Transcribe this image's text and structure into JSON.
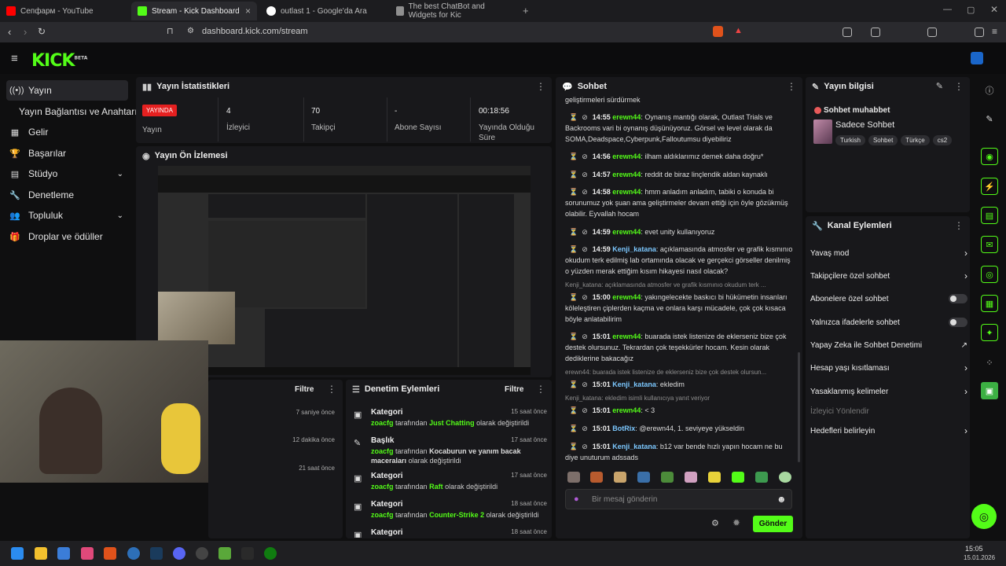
{
  "browser": {
    "tabs": [
      {
        "title": "Сепфарм - YouTube",
        "color": "#ff0000"
      },
      {
        "title": "Stream - Kick Dashboard",
        "color": "#53fc18"
      },
      {
        "title": "outlast 1 - Google'da Ara",
        "color": "#ffffff"
      },
      {
        "title": "The best ChatBot and Widgets for Kic",
        "color": "#8f8f8f"
      }
    ],
    "url": "dashboard.kick.com/stream"
  },
  "logo": {
    "text": "KICK",
    "beta": "BETA"
  },
  "sidebar": {
    "items": [
      {
        "icon": "((•))",
        "label": "Yayın"
      },
      {
        "icon": "",
        "label": "Yayın Bağlantısı ve Anahtarı"
      },
      {
        "icon": "▦",
        "label": "Gelir"
      },
      {
        "icon": "🏆",
        "label": "Başarılar"
      },
      {
        "icon": "▤",
        "label": "Stüdyo"
      },
      {
        "icon": "🔧",
        "label": "Denetleme"
      },
      {
        "icon": "👥",
        "label": "Topluluk"
      },
      {
        "icon": "🎁",
        "label": "Droplar ve ödüller"
      }
    ]
  },
  "stats": {
    "title": "Yayın İstatistikleri",
    "live_badge": "YAYINDA",
    "status_label": "Yayın",
    "viewers": {
      "value": "4",
      "label": "İzleyici"
    },
    "followers": {
      "value": "70",
      "label": "Takipçi"
    },
    "subs": {
      "value": "-",
      "label": "Abone Sayısı"
    },
    "uptime": {
      "value": "00:18:56",
      "label": "Yayında Olduğu Süre"
    }
  },
  "preview": {
    "title": "Yayın Ön İzlemesi"
  },
  "activity": {
    "filter": "Filtre",
    "times": [
      "7 saniye önce",
      "12 dakika önce",
      "21 saat önce"
    ]
  },
  "moderation": {
    "title": "Denetim Eylemleri",
    "filter": "Filtre",
    "items": [
      {
        "title": "Kategori",
        "user": "zoacfg",
        "pre": "tarafından",
        "value": "Just Chatting",
        "post": "olarak değiştirildi",
        "time": "15 saat önce"
      },
      {
        "title": "Başlık",
        "user": "zoacfg",
        "pre": "tarafından",
        "value": "Kocaburun ve yanım bacak maceraları",
        "post": "olarak değiştirildi",
        "time": "17 saat önce"
      },
      {
        "title": "Kategori",
        "user": "zoacfg",
        "pre": "tarafından",
        "value": "Raft",
        "post": "olarak değiştirildi",
        "time": "17 saat önce"
      },
      {
        "title": "Kategori",
        "user": "zoacfg",
        "pre": "tarafından",
        "value": "Counter-Strike 2",
        "post": "olarak değiştirildi",
        "time": "18 saat önce"
      },
      {
        "title": "Kategori",
        "user": "",
        "pre": "",
        "value": "",
        "post": "",
        "time": "18 saat önce"
      }
    ]
  },
  "chat": {
    "title": "Sohbet",
    "top": "geliştirmeleri sürdürmek",
    "messages": [
      {
        "time": "14:55",
        "user": "erewn44",
        "text": "Oynanış mantığı olarak, Outlast Trials ve Backrooms vari bi oynanış düşünüyoruz. Görsel ve level olarak da SOMA,Deadspace,Cyberpunk,Falloutumsu diyebiliriz"
      },
      {
        "time": "14:56",
        "user": "erewn44",
        "text": "ilham aldıklarımız demek daha doğru*"
      },
      {
        "time": "14:57",
        "user": "erewn44",
        "text": "reddit de biraz linçlendik aldan kaynaklı"
      },
      {
        "time": "14:58",
        "user": "erewn44",
        "text": "hmm anladım anladım, tabiki o konuda bi sorunumuz yok şuan ama geliştirmeler devam ettiği için öyle gözükmüş olabilir. Eyvallah hocam"
      },
      {
        "time": "14:59",
        "user": "erewn44",
        "text": "evet unity kullanıyoruz"
      },
      {
        "time": "14:59",
        "user": "Kenji_katana",
        "text": "açıklamasında atmosfer ve grafik kısmınıo okudum terk edilmiş lab ortamında olacak ve gerçekci görseller denilmiş o yüzden merak ettiğim kısım hikayesi nasıl olacak?"
      },
      {
        "time": "15:00",
        "user": "erewn44",
        "text": "yakıngelecekte baskıcı bi hükümetin insanları köleleştiren çiplerden kaçma ve onlara karşı mücadele, çok çok kısaca böyle anlatabilirim"
      },
      {
        "time": "15:01",
        "user": "erewn44",
        "text": "buarada istek listenize de eklerseniz bize çok destek olursunuz. Tekrardan çok teşekkürler hocam. Kesin olarak dediklerine bakacağız"
      },
      {
        "time": "15:01",
        "user": "Kenji_katana",
        "text": "ekledim"
      },
      {
        "time": "15:01",
        "user": "erewn44",
        "text": "< 3"
      },
      {
        "time": "15:01",
        "user": "BotRix",
        "text": "@erewn44, 1. seviyeye yükseldin"
      },
      {
        "time": "15:01",
        "user": "Kenji_katana",
        "text": "b12 var bende hızlı yapın hocam ne bu diye unuturum adssads"
      }
    ],
    "replies": [
      "Kenji_katana: açıklamasında atmosfer ve grafik kısmınıo okudum terk ...",
      "erewn44: buarada istek listenize de eklerseniz bize çok destek olursun...",
      "Kenji_katana: ekledim isimli kullanıcıya yanıt veriyor"
    ],
    "placeholder": "Bir mesaj gönderin",
    "send": "Gönder"
  },
  "info": {
    "title": "Yayın bilgisi",
    "stream_title": "Sohbet muhabbet",
    "category": "Sadece Sohbet",
    "tags": [
      "Turkish",
      "Sohbet",
      "Türkçe",
      "cs2"
    ]
  },
  "actions": {
    "title": "Kanal Eylemleri",
    "items": [
      {
        "label": "Yavaş mod",
        "kind": "chevron"
      },
      {
        "label": "Takipçilere özel sohbet",
        "kind": "chevron"
      },
      {
        "label": "Abonelere özel sohbet",
        "kind": "toggle"
      },
      {
        "label": "Yalnızca ifadelerle sohbet",
        "kind": "toggle"
      },
      {
        "label": "Yapay Zeka ile Sohbet Denetimi",
        "kind": "external"
      },
      {
        "label": "Hesap yaşı kısıtlaması",
        "kind": "chevron"
      },
      {
        "label": "Yasaklanmış kelimeler",
        "kind": "chevron"
      },
      {
        "label": "İzleyici Yönlendir",
        "kind": "disabled"
      },
      {
        "label": "Hedefleri belirleyin",
        "kind": "chevron"
      }
    ]
  },
  "taskbar": {
    "time": "15:05",
    "date": "15.01.2026"
  },
  "colors": {
    "accent": "#53fc18",
    "live": "#e52020",
    "panel": "#18181b"
  }
}
